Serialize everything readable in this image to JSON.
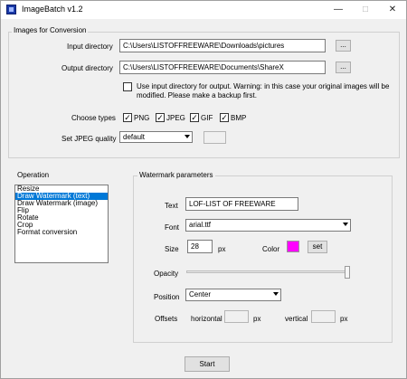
{
  "window": {
    "title": "ImageBatch v1.2"
  },
  "conversion": {
    "legend": "Images for Conversion",
    "input_label": "Input directory",
    "input_value": "C:\\Users\\LISTOFFREEWARE\\Downloads\\pictures",
    "input_browse": "...",
    "output_label": "Output directory",
    "output_value": "C:\\Users\\LISTOFFREEWARE\\Documents\\ShareX",
    "output_browse": "...",
    "use_input_line1": "Use input directory for output. Warning: in this case your original images will be",
    "use_input_line2": "modified. Please make a backup first.",
    "types_label": "Choose types",
    "types": [
      {
        "label": "PNG",
        "checked": true
      },
      {
        "label": "JPEG",
        "checked": true
      },
      {
        "label": "GIF",
        "checked": true
      },
      {
        "label": "BMP",
        "checked": true
      }
    ],
    "jpeg_quality_label": "Set JPEG quality",
    "jpeg_quality_value": "default"
  },
  "operation": {
    "label": "Operation",
    "items": [
      "Resize",
      "Draw Watermark (text)",
      "Draw Watermark (image)",
      "Flip",
      "Rotate",
      "Crop",
      "Format conversion"
    ],
    "selected_index": 1
  },
  "watermark": {
    "legend": "Watermark parameters",
    "text_label": "Text",
    "text_value": "LOF-LIST OF FREEWARE",
    "font_label": "Font",
    "font_value": "arial.ttf",
    "size_label": "Size",
    "size_value": "28",
    "size_unit": "px",
    "color_label": "Color",
    "color_value": "#ff00ff",
    "set_label": "set",
    "opacity_label": "Opacity",
    "opacity_level": 1.0,
    "position_label": "Position",
    "position_value": "Center",
    "offsets_label": "Offsets",
    "horizontal_label": "horizontal",
    "horizontal_unit": "px",
    "vertical_label": "vertical",
    "vertical_unit": "px"
  },
  "start_label": "Start"
}
